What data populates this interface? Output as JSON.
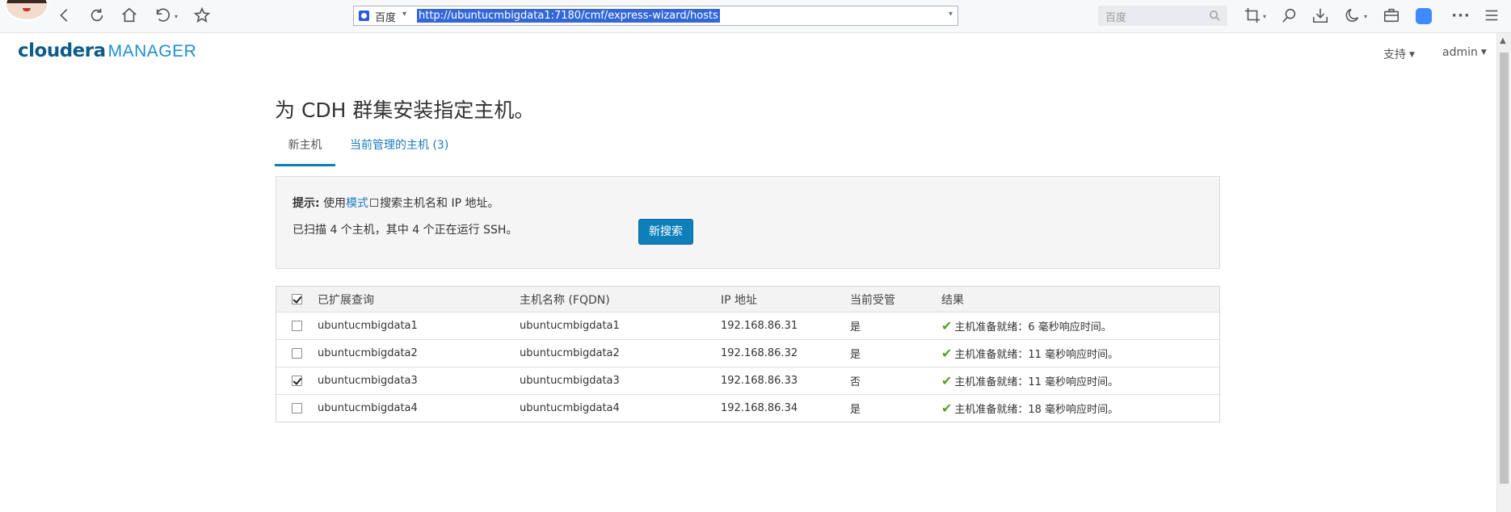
{
  "browser": {
    "search_engine": "百度",
    "url": "http://ubuntucmbigdata1:7180/cmf/express-wizard/hosts",
    "search_placeholder": "百度"
  },
  "app": {
    "logo_primary": "cloudera",
    "logo_secondary": "MANAGER",
    "menu_support": "支持",
    "menu_user": "admin"
  },
  "page": {
    "title": "为 CDH 群集安装指定主机。",
    "tabs": [
      {
        "label": "新主机",
        "active": true
      },
      {
        "label": "当前管理的主机 (3)",
        "active": false
      }
    ]
  },
  "info": {
    "hint_label": "提示:",
    "hint_prefix": "使用",
    "hint_link": "模式",
    "hint_suffix": "搜索主机名和 IP 地址。",
    "scan_result": "已扫描 4 个主机，其中 4 个正在运行 SSH。",
    "search_button": "新搜索"
  },
  "table": {
    "header_checked": true,
    "columns": [
      "已扩展查询",
      "主机名称 (FQDN)",
      "IP 地址",
      "当前受管",
      "结果"
    ],
    "rows": [
      {
        "checked": false,
        "query": "ubuntucmbigdata1",
        "fqdn": "ubuntucmbigdata1",
        "ip": "192.168.86.31",
        "managed": "是",
        "result": "主机准备就绪：6 毫秒响应时间。"
      },
      {
        "checked": false,
        "query": "ubuntucmbigdata2",
        "fqdn": "ubuntucmbigdata2",
        "ip": "192.168.86.32",
        "managed": "是",
        "result": "主机准备就绪：11 毫秒响应时间。"
      },
      {
        "checked": true,
        "query": "ubuntucmbigdata3",
        "fqdn": "ubuntucmbigdata3",
        "ip": "192.168.86.33",
        "managed": "否",
        "result": "主机准备就绪：11 毫秒响应时间。"
      },
      {
        "checked": false,
        "query": "ubuntucmbigdata4",
        "fqdn": "ubuntucmbigdata4",
        "ip": "192.168.86.34",
        "managed": "是",
        "result": "主机准备就绪：18 毫秒响应时间。"
      }
    ]
  }
}
